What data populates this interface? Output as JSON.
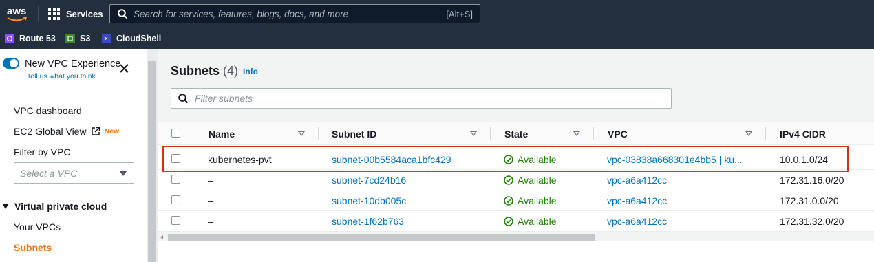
{
  "topnav": {
    "logo": "aws",
    "services_label": "Services",
    "search_placeholder": "Search for services, features, blogs, docs, and more",
    "search_shortcut": "[Alt+S]"
  },
  "favorites": [
    {
      "label": "Route 53",
      "icon": "route53-icon",
      "color": "#8c4fff"
    },
    {
      "label": "S3",
      "icon": "s3-icon",
      "color": "#3f8624"
    },
    {
      "label": "CloudShell",
      "icon": "cloudshell-icon",
      "color": "#3b48cc"
    }
  ],
  "sidebar": {
    "toggle_label": "New VPC Experience",
    "tell_us": "Tell us what you think",
    "items": {
      "vpc_dashboard": "VPC dashboard",
      "ec2_global_view": "EC2 Global View",
      "new_badge": "New",
      "filter_by_vpc": "Filter by VPC:",
      "select_placeholder": "Select a VPC",
      "section": "Virtual private cloud",
      "your_vpcs": "Your VPCs",
      "subnets": "Subnets"
    }
  },
  "main": {
    "title": "Subnets",
    "count": "(4)",
    "info": "Info",
    "filter_placeholder": "Filter subnets",
    "columns": [
      "Name",
      "Subnet ID",
      "State",
      "VPC",
      "IPv4 CIDR"
    ],
    "rows": [
      {
        "name": "kubernetes-pvt",
        "subnet_id": "subnet-00b5584aca1bfc429",
        "state": "Available",
        "vpc": "vpc-03838a668301e4bb5 | ku...",
        "cidr": "10.0.1.0/24"
      },
      {
        "name": "–",
        "subnet_id": "subnet-7cd24b16",
        "state": "Available",
        "vpc": "vpc-a6a412cc",
        "cidr": "172.31.16.0/20"
      },
      {
        "name": "–",
        "subnet_id": "subnet-10db005c",
        "state": "Available",
        "vpc": "vpc-a6a412cc",
        "cidr": "172.31.0.0/20"
      },
      {
        "name": "–",
        "subnet_id": "subnet-1f62b763",
        "state": "Available",
        "vpc": "vpc-a6a412cc",
        "cidr": "172.31.32.0/20"
      }
    ]
  },
  "colors": {
    "nav_bg": "#232f3e",
    "link": "#0073bb",
    "accent_orange": "#ec7211",
    "status_green": "#1d8102",
    "highlight_red": "#d13212"
  }
}
